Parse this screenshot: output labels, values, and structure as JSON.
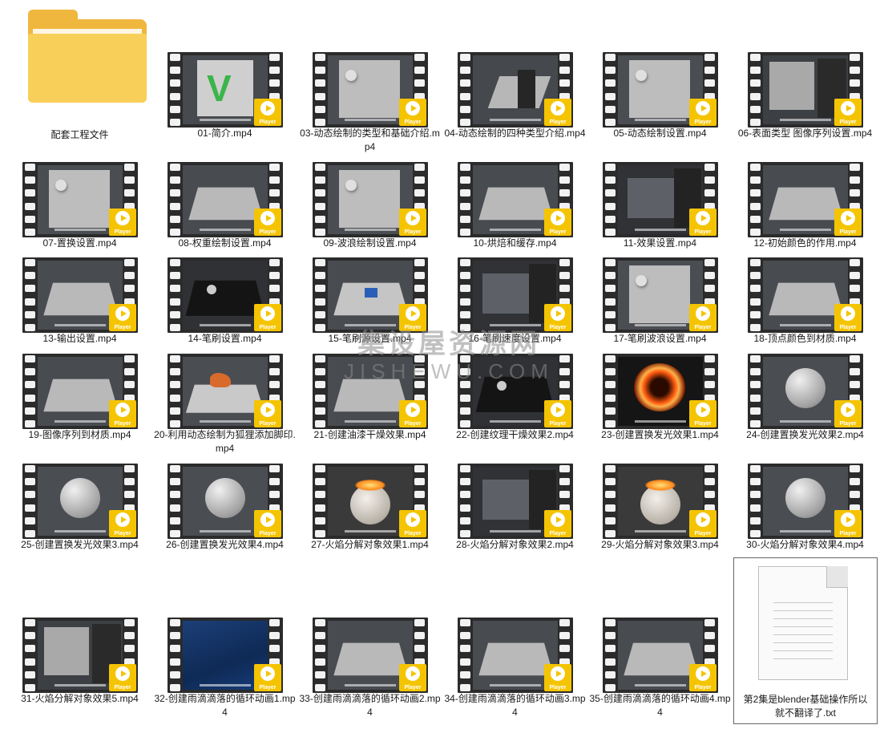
{
  "watermark": {
    "title": "集设屋资源网",
    "url": "JISHEWU.COM"
  },
  "play_badge": "Player",
  "folder": {
    "label": "配套工程文件"
  },
  "text_file": {
    "label": "第2集是blender基础操作所以就不翻译了.txt"
  },
  "videos": [
    {
      "label": "01-简介.mp4",
      "style": "v"
    },
    {
      "label": "03-动态绘制的类型和基础介绍.mp4",
      "style": "ball"
    },
    {
      "label": "04-动态绘制的四种类型介绍.mp4",
      "style": "menu"
    },
    {
      "label": "05-动态绘制设置.mp4",
      "style": "ball"
    },
    {
      "label": "06-表面类型 图像序列设置.mp4",
      "style": "panel"
    },
    {
      "label": "07-置换设置.mp4",
      "style": "ball"
    },
    {
      "label": "08-权重绘制设置.mp4",
      "style": "plane"
    },
    {
      "label": "09-波浪绘制设置.mp4",
      "style": "ball"
    },
    {
      "label": "10-烘焙和缓存.mp4",
      "style": "plane"
    },
    {
      "label": "11-效果设置.mp4",
      "style": "dark"
    },
    {
      "label": "12-初始颜色的作用.mp4",
      "style": "plane"
    },
    {
      "label": "13-输出设置.mp4",
      "style": "plane"
    },
    {
      "label": "14-笔刷设置.mp4",
      "style": "black"
    },
    {
      "label": "15-笔刷源设置.mp4",
      "style": "blue"
    },
    {
      "label": "16-笔刷速度设置.mp4",
      "style": "dark"
    },
    {
      "label": "17-笔刷波浪设置.mp4",
      "style": "ball"
    },
    {
      "label": "18-顶点颜色到材质.mp4",
      "style": "plane"
    },
    {
      "label": "19-图像序列到材质.mp4",
      "style": "plane"
    },
    {
      "label": "20-利用动态绘制为狐狸添加脚印.mp4",
      "style": "fox"
    },
    {
      "label": "21-创建油漆干燥效果.mp4",
      "style": "plane"
    },
    {
      "label": "22-创建纹理干燥效果2.mp4",
      "style": "black"
    },
    {
      "label": "23-创建置换发光效果1.mp4",
      "style": "fire"
    },
    {
      "label": "24-创建置换发光效果2.mp4",
      "style": "sphere"
    },
    {
      "label": "25-创建置换发光效果3.mp4",
      "style": "sphere"
    },
    {
      "label": "26-创建置换发光效果4.mp4",
      "style": "sphere"
    },
    {
      "label": "27-火焰分解对象效果1.mp4",
      "style": "glow"
    },
    {
      "label": "28-火焰分解对象效果2.mp4",
      "style": "dark"
    },
    {
      "label": "29-火焰分解对象效果3.mp4",
      "style": "glow"
    },
    {
      "label": "30-火焰分解对象效果4.mp4",
      "style": "sphere"
    },
    {
      "label": "31-火焰分解对象效果5.mp4",
      "style": "panel"
    },
    {
      "label": "32-创建雨滴滴落的循环动画1.mp4",
      "style": "water"
    },
    {
      "label": "33-创建雨滴滴落的循环动画2.mp4",
      "style": "plane"
    },
    {
      "label": "34-创建雨滴滴落的循环动画3.mp4",
      "style": "plane"
    },
    {
      "label": "35-创建雨滴滴落的循环动画4.mp4",
      "style": "plane"
    }
  ]
}
